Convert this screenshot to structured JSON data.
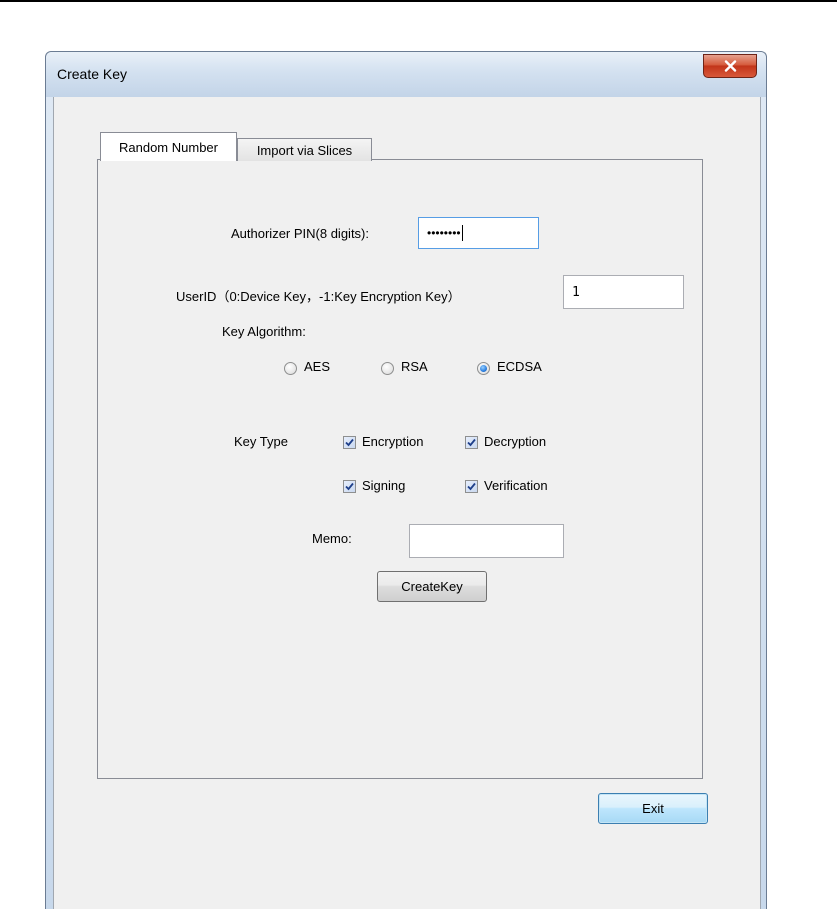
{
  "window": {
    "title": "Create Key"
  },
  "tabs": [
    {
      "label": "Random Number",
      "active": true
    },
    {
      "label": "Import via Slices",
      "active": false
    }
  ],
  "form": {
    "pin_label": "Authorizer PIN(8 digits):",
    "pin_value": "••••••••",
    "userid_label": "UserID（0:Device Key，-1:Key Encryption Key）",
    "userid_value": "1",
    "algorithm_label": "Key Algorithm:",
    "algorithms": [
      {
        "label": "AES",
        "checked": false
      },
      {
        "label": "RSA",
        "checked": false
      },
      {
        "label": "ECDSA",
        "checked": true
      }
    ],
    "keytype_label": "Key Type",
    "keytypes": [
      {
        "label": "Encryption",
        "checked": true
      },
      {
        "label": "Decryption",
        "checked": true
      },
      {
        "label": "Signing",
        "checked": true
      },
      {
        "label": "Verification",
        "checked": true
      }
    ],
    "memo_label": "Memo:",
    "memo_value": "",
    "create_button": "CreateKey"
  },
  "buttons": {
    "exit": "Exit"
  },
  "colors": {
    "accent": "#569de5",
    "close_red": "#c2351a",
    "panel_bg": "#f0f0f0"
  }
}
